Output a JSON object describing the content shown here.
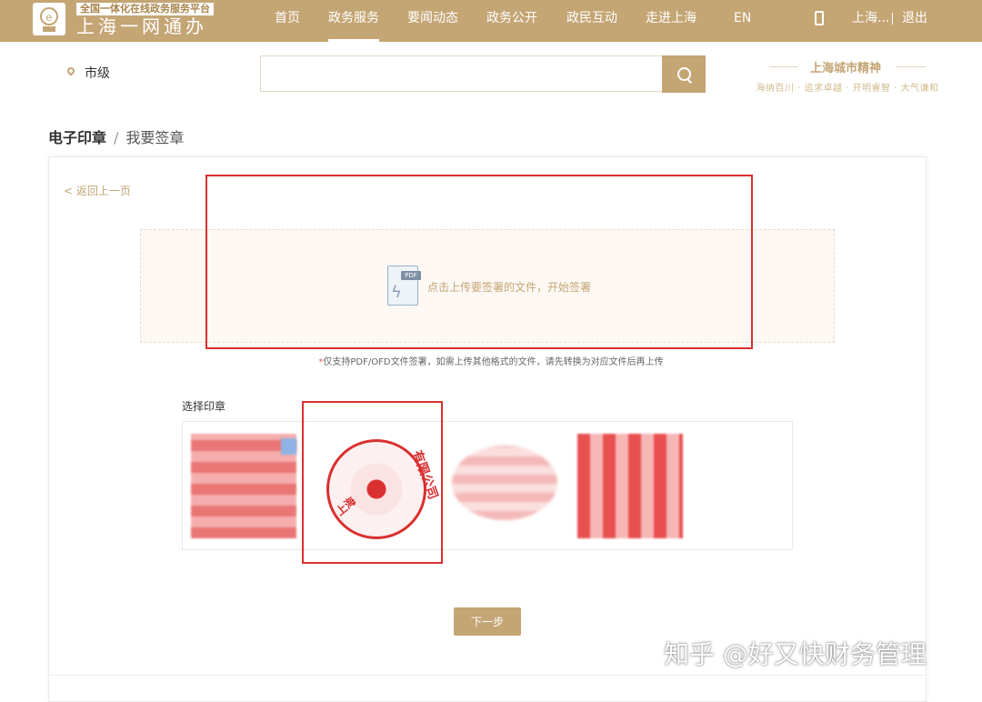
{
  "header": {
    "platform_tag": "全国一体化在线政务服务平台",
    "site_name": "上海一网通办",
    "nav": [
      "首页",
      "政务服务",
      "要闻动态",
      "政务公开",
      "政民互动",
      "走进上海",
      "EN"
    ],
    "active_nav": "政务服务",
    "user_text": "上海...",
    "logout": "退出"
  },
  "search": {
    "location": "市级",
    "placeholder": "",
    "slogan_title": "上海城市精神",
    "slogan_sub": "海纳百川 · 追求卓越 · 开明睿智 · 大气谦和"
  },
  "breadcrumb": {
    "section": "电子印章",
    "separator": "/",
    "page": "我要签章"
  },
  "main": {
    "back_link": "< 返回上一页",
    "pdf_tag": "PDF",
    "upload_text": "点击上传要签署的文件，开始签署",
    "hint_star": "*",
    "hint": "仅支持PDF/OFD文件签署，如需上传其他格式的文件，请先转换为对应文件后再上传",
    "seal_label": "选择印章",
    "seal2_text_a": "有限公司",
    "seal2_text_b": "上海",
    "next_button": "下一步"
  },
  "watermark": "知乎 @好又快财务管理",
  "colors": {
    "brand": "#c4a574",
    "annotation_red": "#d93030"
  },
  "icons": [
    "logo-icon",
    "phone-icon",
    "location-pin-icon",
    "search-icon",
    "pdf-file-icon"
  ]
}
